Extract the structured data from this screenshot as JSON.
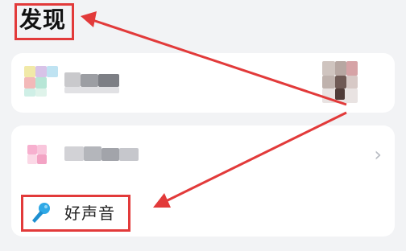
{
  "page": {
    "title": "发现"
  },
  "feature": {
    "label": "好声音",
    "icon": "microphone-icon"
  },
  "list": {
    "chevron": "›"
  },
  "colors": {
    "highlight_red": "#e23a3a",
    "mic_blue": "#2ea8e6",
    "background": "#f2f3f5"
  }
}
